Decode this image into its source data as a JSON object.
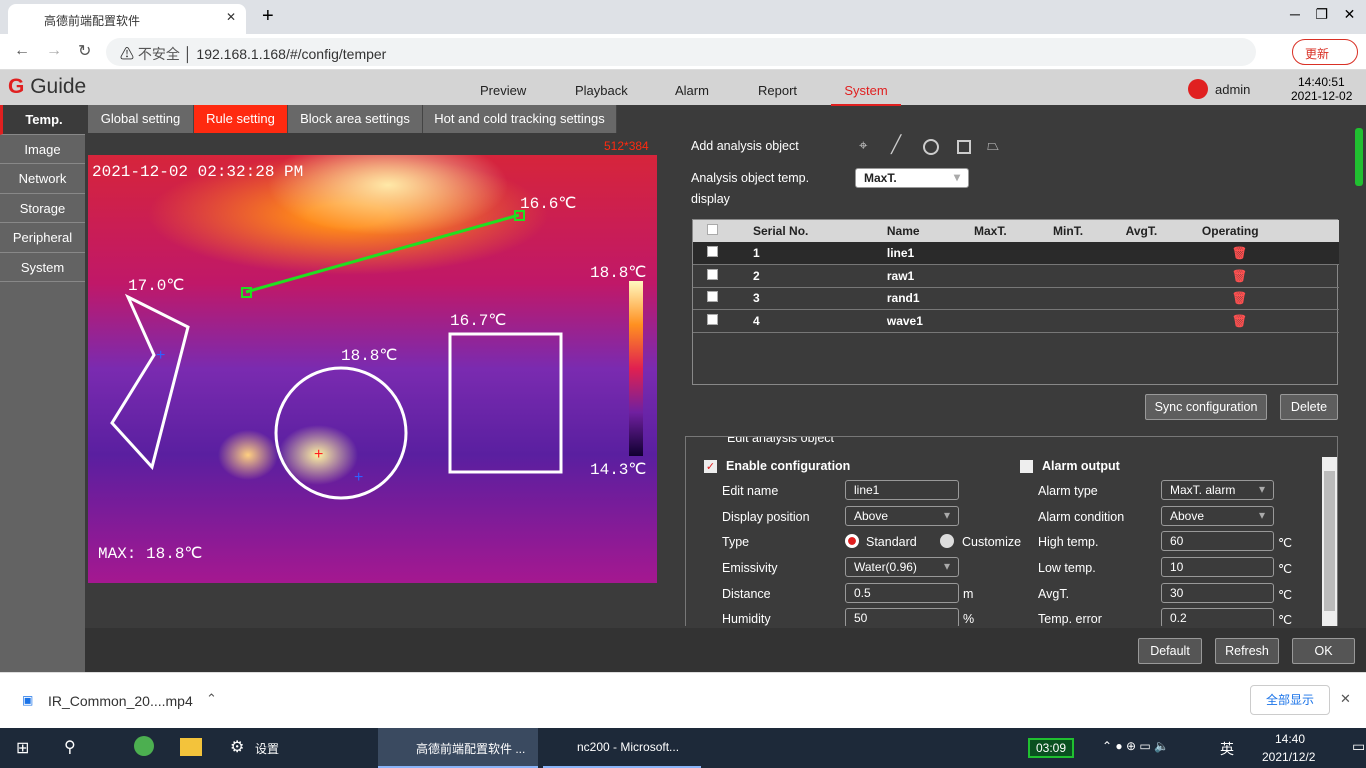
{
  "browser": {
    "tab_title": "高德前端配置软件",
    "insecure": "不安全",
    "url": "192.168.1.168/#/config/temper",
    "update": "更新"
  },
  "app": {
    "logo": "Guide",
    "nav": [
      "Preview",
      "Playback",
      "Alarm",
      "Report",
      "System"
    ],
    "active_nav": "System",
    "user": "admin",
    "time": "14:40:51",
    "date": "2021-12-02"
  },
  "sidebar": [
    "Temp.",
    "Image",
    "Network",
    "Storage",
    "Peripheral",
    "System"
  ],
  "subtabs": [
    "Global setting",
    "Rule setting",
    "Block area settings",
    "Hot and cold tracking settings"
  ],
  "image": {
    "resolution": "512*384",
    "timestamp": "2021-12-02 02:32:28 PM",
    "max": "MAX: 18.8℃",
    "scale_high": "18.8℃",
    "scale_low": "14.3℃",
    "labels": [
      "16.6℃",
      "17.0℃",
      "18.8℃",
      "16.7℃"
    ]
  },
  "panel": {
    "add_label": "Add analysis object",
    "temp_display_label": "Analysis object temp.",
    "temp_display_label2": "display",
    "temp_display_value": "MaxT.",
    "columns": [
      "Serial No.",
      "Name",
      "MaxT.",
      "MinT.",
      "AvgT.",
      "Operating"
    ],
    "rows": [
      {
        "no": "1",
        "name": "line1"
      },
      {
        "no": "2",
        "name": "raw1"
      },
      {
        "no": "3",
        "name": "rand1"
      },
      {
        "no": "4",
        "name": "wave1"
      }
    ],
    "sync": "Sync configuration",
    "delete": "Delete"
  },
  "edit": {
    "legend": "Edit analysis object",
    "enable": "Enable configuration",
    "alarm_output": "Alarm output",
    "edit_name_label": "Edit name",
    "edit_name": "line1",
    "display_position_label": "Display position",
    "display_position": "Above",
    "type_label": "Type",
    "standard": "Standard",
    "customize": "Customize",
    "emissivity_label": "Emissivity",
    "emissivity": "Water(0.96)",
    "distance_label": "Distance",
    "distance": "0.5",
    "distance_unit": "m",
    "humidity_label": "Humidity",
    "humidity": "50",
    "humidity_unit": "%",
    "alarm_type_label": "Alarm type",
    "alarm_type": "MaxT. alarm",
    "alarm_condition_label": "Alarm condition",
    "alarm_condition": "Above",
    "high_label": "High temp.",
    "high": "60",
    "low_label": "Low temp.",
    "low": "10",
    "avg_label": "AvgT.",
    "avg": "30",
    "err_label": "Temp. error",
    "err": "0.2",
    "unit": "℃"
  },
  "footer": {
    "default": "Default",
    "refresh": "Refresh",
    "ok": "OK"
  },
  "download": {
    "file": "IR_Common_20....mp4",
    "show_all": "全部显示"
  },
  "taskbar": {
    "settings": "设置",
    "chrome": "高德前端配置软件 ...",
    "word": "nc200 - Microsoft...",
    "battery": "03:09",
    "ime": "英",
    "time": "14:40",
    "date": "2021/12/2"
  }
}
